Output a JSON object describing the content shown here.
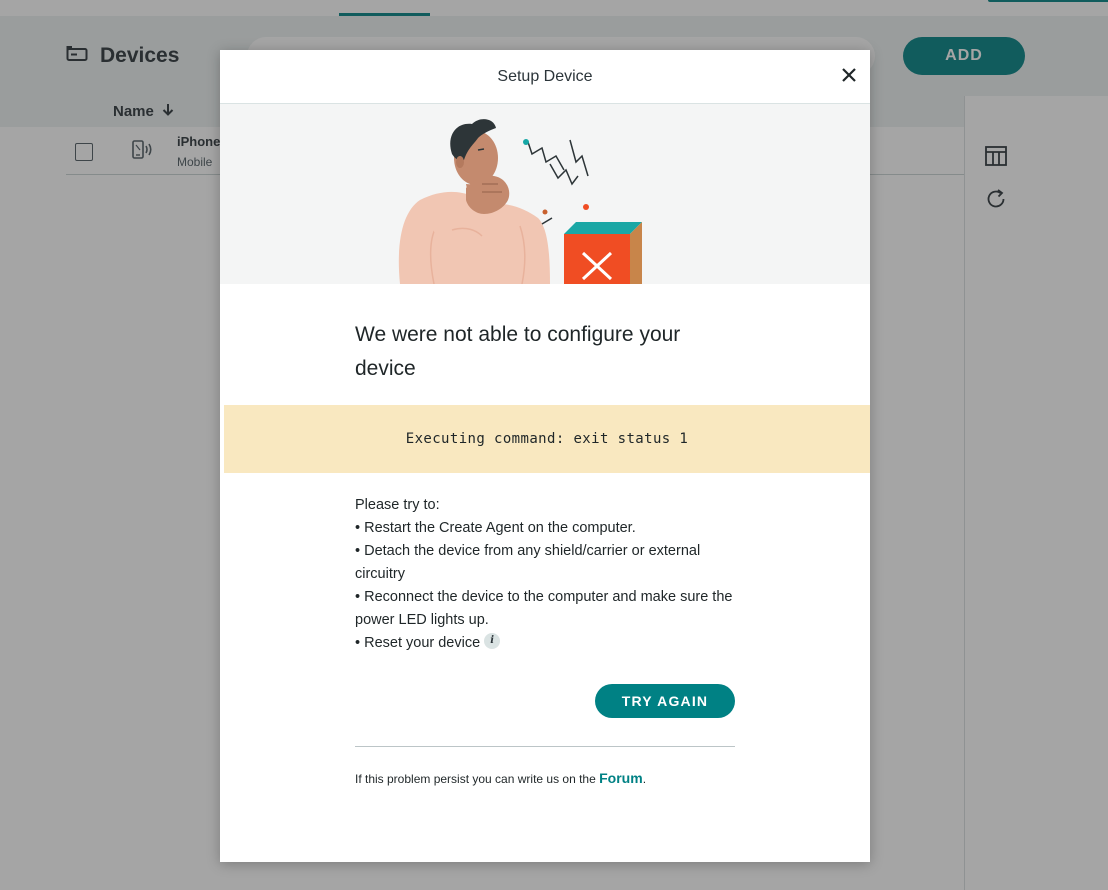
{
  "app": {
    "page_title": "Devices",
    "add_label": "ADD",
    "column_name": "Name"
  },
  "devices": [
    {
      "name": "iPhone",
      "type": "Mobile"
    }
  ],
  "modal": {
    "title": "Setup Device",
    "headline": "We were not able to configure your device",
    "error_message": "Executing command: exit status 1",
    "tips_intro": "Please try to:",
    "tips": [
      "• Restart the Create Agent on the computer.",
      "• Detach the device from any shield/carrier or external circuitry",
      "• Reconnect the device to the computer and make sure the power LED lights up.",
      "• Reset your device"
    ],
    "try_again_label": "TRY AGAIN",
    "footer_prefix": "If this problem persist you can write us on the ",
    "footer_link": "Forum",
    "footer_suffix": "."
  },
  "colors": {
    "accent": "#008184",
    "error_banner": "#f9e8c0",
    "error_box": "#f04d23"
  },
  "icons": [
    "devices-icon",
    "arrow-down-icon",
    "mobile-device-icon",
    "table-layout-icon",
    "refresh-icon",
    "close-icon",
    "info-icon"
  ]
}
